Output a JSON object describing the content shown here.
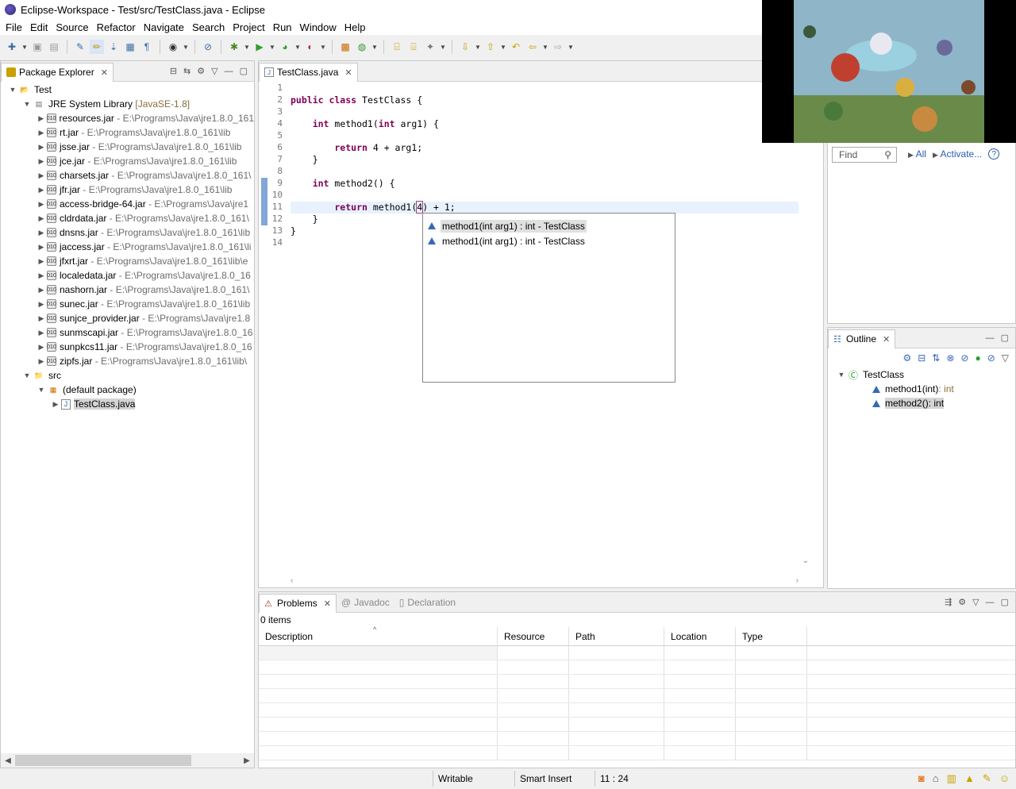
{
  "window": {
    "title": "Eclipse-Workspace - Test/src/TestClass.java - Eclipse"
  },
  "menu": [
    "File",
    "Edit",
    "Source",
    "Refactor",
    "Navigate",
    "Search",
    "Project",
    "Run",
    "Window",
    "Help"
  ],
  "package_explorer": {
    "tab_label": "Package Explorer",
    "project": "Test",
    "jre": {
      "label": "JRE System Library",
      "decoration": "[JavaSE-1.8]"
    },
    "jars": [
      {
        "name": "resources.jar",
        "path": "- E:\\Programs\\Java\\jre1.8.0_161"
      },
      {
        "name": "rt.jar",
        "path": "- E:\\Programs\\Java\\jre1.8.0_161\\lib"
      },
      {
        "name": "jsse.jar",
        "path": "- E:\\Programs\\Java\\jre1.8.0_161\\lib"
      },
      {
        "name": "jce.jar",
        "path": "- E:\\Programs\\Java\\jre1.8.0_161\\lib"
      },
      {
        "name": "charsets.jar",
        "path": "- E:\\Programs\\Java\\jre1.8.0_161\\"
      },
      {
        "name": "jfr.jar",
        "path": "- E:\\Programs\\Java\\jre1.8.0_161\\lib"
      },
      {
        "name": "access-bridge-64.jar",
        "path": "- E:\\Programs\\Java\\jre1"
      },
      {
        "name": "cldrdata.jar",
        "path": "- E:\\Programs\\Java\\jre1.8.0_161\\"
      },
      {
        "name": "dnsns.jar",
        "path": "- E:\\Programs\\Java\\jre1.8.0_161\\lib"
      },
      {
        "name": "jaccess.jar",
        "path": "- E:\\Programs\\Java\\jre1.8.0_161\\li"
      },
      {
        "name": "jfxrt.jar",
        "path": "- E:\\Programs\\Java\\jre1.8.0_161\\lib\\e"
      },
      {
        "name": "localedata.jar",
        "path": "- E:\\Programs\\Java\\jre1.8.0_16"
      },
      {
        "name": "nashorn.jar",
        "path": "- E:\\Programs\\Java\\jre1.8.0_161\\"
      },
      {
        "name": "sunec.jar",
        "path": "- E:\\Programs\\Java\\jre1.8.0_161\\lib"
      },
      {
        "name": "sunjce_provider.jar",
        "path": "- E:\\Programs\\Java\\jre1.8"
      },
      {
        "name": "sunmscapi.jar",
        "path": "- E:\\Programs\\Java\\jre1.8.0_16"
      },
      {
        "name": "sunpkcs11.jar",
        "path": "- E:\\Programs\\Java\\jre1.8.0_16"
      },
      {
        "name": "zipfs.jar",
        "path": "- E:\\Programs\\Java\\jre1.8.0_161\\lib\\"
      }
    ],
    "src": "src",
    "default_package": "(default package)",
    "file": "TestClass.java"
  },
  "editor": {
    "tab_label": "TestClass.java",
    "line_numbers": [
      "1",
      "2",
      "3",
      "4",
      "5",
      "6",
      "7",
      "8",
      "9",
      "10",
      "11",
      "12",
      "13",
      "14"
    ],
    "code": {
      "l2_a": "public class",
      "l2_b": " TestClass {",
      "l4_a": "    int",
      "l4_b": " method1(",
      "l4_c": "int",
      "l4_d": " arg1) {",
      "l6_a": "        return",
      "l6_b": " 4 + arg1;",
      "l7": "    }",
      "l9_a": "    int",
      "l9_b": " method2() {",
      "l11_a": "        return",
      "l11_b": " method1(",
      "l11_c": "4",
      "l11_d": ") + 1;",
      "l12": "    }",
      "l13": "}"
    }
  },
  "autocomplete": {
    "items": [
      "method1(int arg1) : int - TestClass",
      "method1(int arg1) : int - TestClass"
    ]
  },
  "task_panel": {
    "find_placeholder": "Find",
    "all": "All",
    "activate": "Activate..."
  },
  "outline": {
    "tab_label": "Outline",
    "class": "TestClass",
    "members": [
      {
        "name": "method1(int)",
        "type": " : int"
      },
      {
        "name": "method2()",
        "type": " : int"
      }
    ]
  },
  "problems": {
    "tabs": [
      "Problems",
      "Javadoc",
      "Declaration"
    ],
    "count": "0 items",
    "columns": [
      "Description",
      "Resource",
      "Path",
      "Location",
      "Type"
    ]
  },
  "status": {
    "writable": "Writable",
    "insert_mode": "Smart Insert",
    "position": "11 : 24"
  },
  "colors": {
    "keyword": "#7f0055",
    "selection": "#e8f2fe",
    "method_icon": "#3668b8"
  }
}
